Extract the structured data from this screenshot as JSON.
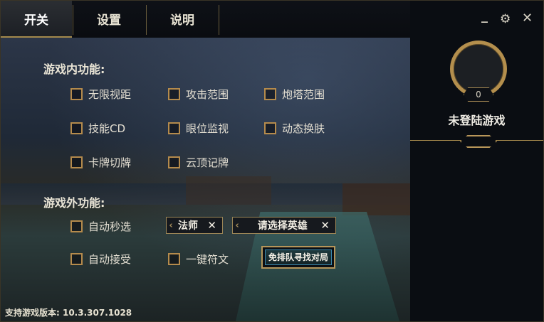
{
  "tabs": [
    {
      "label": "开关",
      "active": true
    },
    {
      "label": "设置",
      "active": false
    },
    {
      "label": "说明",
      "active": false
    }
  ],
  "window_controls": {
    "minimize_icon": "minimize-icon",
    "settings_icon": "gear-icon",
    "close_icon": "close-icon",
    "minimize_glyph": "_",
    "settings_glyph": "⚙",
    "close_glyph": "✕"
  },
  "profile": {
    "level": "0",
    "status": "未登陆游戏"
  },
  "in_game": {
    "title": "游戏内功能:",
    "options": [
      {
        "label": "无限视距",
        "checked": false
      },
      {
        "label": "攻击范围",
        "checked": false
      },
      {
        "label": "炮塔范围",
        "checked": false
      },
      {
        "label": "技能CD",
        "checked": false
      },
      {
        "label": "眼位监视",
        "checked": false
      },
      {
        "label": "动态换肤",
        "checked": false
      },
      {
        "label": "卡牌切牌",
        "checked": false
      },
      {
        "label": "云顶记牌",
        "checked": false
      }
    ]
  },
  "out_game": {
    "title": "游戏外功能:",
    "auto_pick": {
      "label": "自动秒选",
      "checked": false
    },
    "auto_accept": {
      "label": "自动接受",
      "checked": false
    },
    "one_key_rune": {
      "label": "一键符文",
      "checked": false
    },
    "role_select": {
      "value": "法师",
      "clear": "✕"
    },
    "hero_select": {
      "value": "请选择英雄",
      "clear": "✕"
    },
    "queue_button": "免排队寻找对局"
  },
  "footer": {
    "version_text": "支持游戏版本: 10.3.307.1028"
  },
  "colors": {
    "accent_gold": "#b58b4c",
    "button_blue": "#3b8bb0",
    "text": "#e4dfd2"
  }
}
